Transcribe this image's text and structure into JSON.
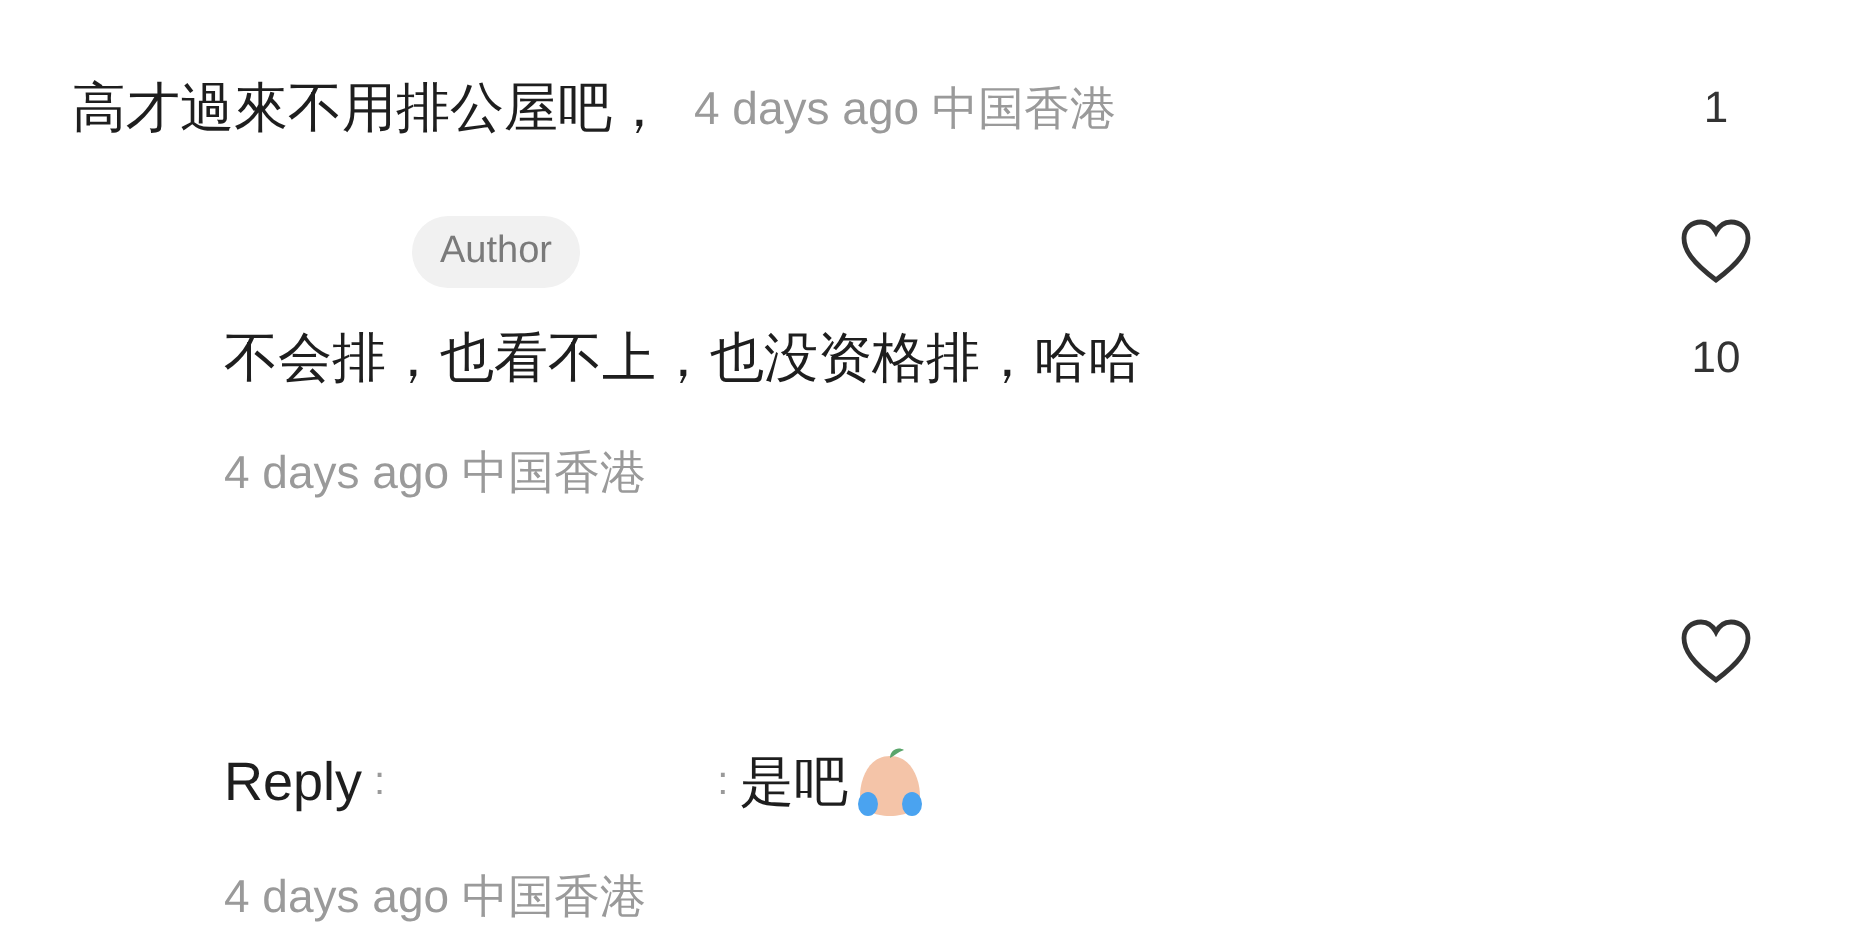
{
  "comment": {
    "text": "高才過來不用排公屋吧，",
    "time": "4 days ago 中国香港",
    "likes": "1"
  },
  "replies": [
    {
      "badge": "Author",
      "text": "不会排，也看不上，也没资格排，哈哈",
      "time": "4 days ago 中国香港",
      "likes": "10",
      "liked": false
    },
    {
      "prefix": "Reply",
      "colon_left": ":",
      "colon_right": ":",
      "text": "是吧",
      "time": "4 days ago 中国香港",
      "liked": false
    }
  ]
}
